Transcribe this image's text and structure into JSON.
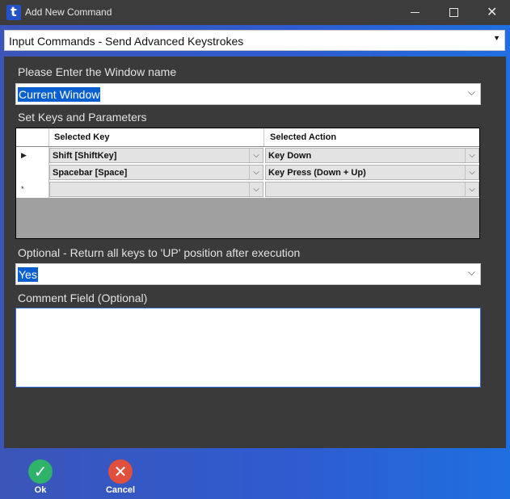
{
  "window": {
    "title": "Add New Command",
    "icon_glyph": "t",
    "minimize_icon": "minimize-icon",
    "maximize_icon": "maximize-icon",
    "close_glyph": "✕"
  },
  "command_select": {
    "value": "Input Commands - Send Advanced Keystrokes",
    "arrow": "▼"
  },
  "form": {
    "window_name_label": "Please Enter the Window name",
    "window_name_value": "Current Window",
    "keys_label": "Set Keys and Parameters",
    "release_label": "Optional - Return all keys to 'UP' position after execution",
    "release_value": "Yes",
    "comment_label": "Comment Field (Optional)",
    "comment_value": ""
  },
  "grid": {
    "columns": [
      "Selected Key",
      "Selected Action"
    ],
    "rows": [
      {
        "marker": "▶",
        "key": "Shift [ShiftKey]",
        "action": "Key Down"
      },
      {
        "marker": "",
        "key": "Spacebar [Space]",
        "action": "Key Press (Down + Up)"
      },
      {
        "marker": "*",
        "key": "",
        "action": ""
      }
    ],
    "dropdown_glyph": "⌵"
  },
  "actions": {
    "ok_label": "Ok",
    "ok_glyph": "✓",
    "ok_color": "#2fb36b",
    "cancel_label": "Cancel",
    "cancel_glyph": "✕",
    "cancel_color": "#e0503c"
  },
  "colors": {
    "accent": "#0a5fd0",
    "panel": "#3a3a3a",
    "titlebar": "#3c3c3c"
  }
}
